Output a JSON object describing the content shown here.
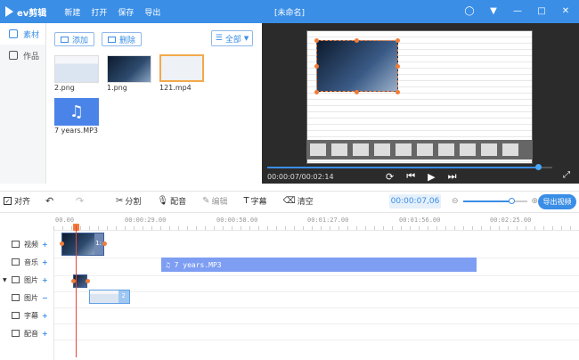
{
  "app": {
    "logo_text": "ev剪辑",
    "menu": [
      "新建",
      "打开",
      "保存",
      "导出"
    ],
    "document_title": "[未命名]",
    "window_controls": [
      "user-icon",
      "skin-icon",
      "minimize-icon",
      "maximize-icon",
      "close-icon"
    ]
  },
  "leftnav": {
    "items": [
      {
        "label": "素材",
        "icon": "grid-icon",
        "active": true
      },
      {
        "label": "作品",
        "icon": "folder-icon",
        "active": false
      }
    ]
  },
  "library": {
    "add_label": "添加",
    "delete_label": "删除",
    "filter_label": "全部",
    "items": [
      {
        "label": "2.png",
        "kind": "screen"
      },
      {
        "label": "1.png",
        "kind": "dark"
      },
      {
        "label": "121.mp4",
        "kind": "selected"
      },
      {
        "label": "7 years.MP3",
        "kind": "audio",
        "icon": "music-note-icon"
      }
    ]
  },
  "preview": {
    "time_display": "00:00:07/00:02:14",
    "progress": 0.95,
    "controls": [
      "rewind-icon",
      "prev-frame-icon",
      "play-icon",
      "next-frame-icon"
    ],
    "fullscreen_icon": "fullscreen-icon"
  },
  "toolbar": {
    "align_label": "对齐",
    "align_checked": true,
    "tools": [
      {
        "label": "分割",
        "icon": "scissors-icon",
        "enabled": true
      },
      {
        "label": "配音",
        "icon": "microphone-icon",
        "enabled": true
      },
      {
        "label": "编辑",
        "icon": "edit-icon",
        "enabled": false
      },
      {
        "label": "字幕",
        "icon": "text-icon",
        "enabled": true
      },
      {
        "label": "清空",
        "icon": "eraser-icon",
        "enabled": true
      }
    ],
    "current_time": "00:00:07,06",
    "zoom_level": 0.75,
    "export_label": "导出视频"
  },
  "timeline": {
    "ruler_labels": [
      "00.00",
      "00:00:29.00",
      "00:00:58.00",
      "00:01:27.00",
      "00:01:56.00",
      "00:02:25.00"
    ],
    "tracks": [
      {
        "label": "视频",
        "icon": "video-icon",
        "action": "+"
      },
      {
        "label": "音乐",
        "icon": "music-icon",
        "action": "+"
      },
      {
        "label": "图片",
        "icon": "image-icon",
        "action": "+"
      },
      {
        "label": "图片",
        "icon": "image-icon",
        "action": "−"
      },
      {
        "label": "字幕",
        "icon": "text-icon",
        "action": "+"
      },
      {
        "label": "配音",
        "icon": "microphone-icon",
        "action": "+"
      }
    ],
    "video_clip_tag": "1:",
    "audio_clip_label": "♫ 7 years.MP3",
    "image_clip_tag": "2"
  }
}
